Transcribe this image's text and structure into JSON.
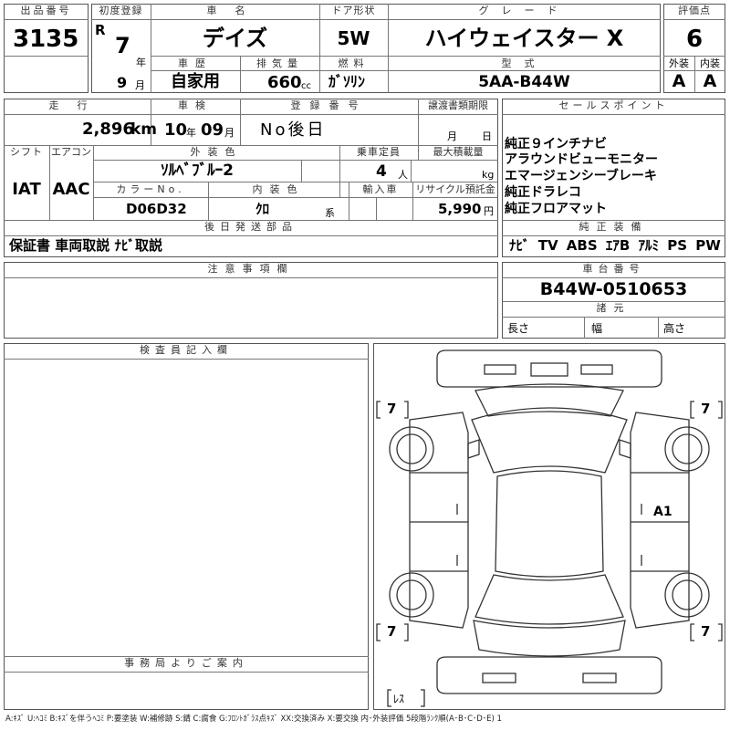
{
  "header": {
    "lot_no_label": "出品番号",
    "lot_no": "3135",
    "first_reg_label": "初度登録",
    "era": "R",
    "year": "7",
    "year_unit": "年",
    "month": "9",
    "month_unit": "月",
    "car_name_label": "車名",
    "car_name": "デイズ",
    "door_label": "ドア形状",
    "door": "5W",
    "grade_label": "グレード",
    "grade": "ハイウェイスター X",
    "score_label": "評価点",
    "score": "6",
    "history_label": "車歴",
    "history": "自家用",
    "displacement_label": "排気量",
    "displacement": "660",
    "displacement_unit": "cc",
    "fuel_label": "燃料",
    "fuel": "ｶﾞｿﾘﾝ",
    "model_label": "型式",
    "model": "5AA-B44W",
    "exterior_label": "外装",
    "exterior": "A",
    "interior_label": "内装",
    "interior": "A"
  },
  "row2": {
    "mileage_label": "走行",
    "mileage": "2,896",
    "mileage_unit": "km",
    "inspection_label": "車検",
    "insp_year": "10",
    "insp_year_unit": "年",
    "insp_month": "09",
    "insp_month_unit": "月",
    "reg_no_label": "登録番号",
    "reg_no": "No後日",
    "transfer_label": "譲渡書類期限",
    "transfer_month_unit": "月",
    "transfer_day_unit": "日",
    "shift_label": "シフト",
    "shift": "IAT",
    "ac_label": "エアコン",
    "ac": "AAC",
    "color_label": "外装色",
    "color": "ｿﾙﾍﾞﾌﾞﾙｰ2",
    "capacity_label": "乗車定員",
    "capacity": "4",
    "capacity_unit": "人",
    "load_label": "最大積載量",
    "load_unit": "kg",
    "color_no_label": "カラーNo.",
    "color_no": "D06D32",
    "int_color_label": "内装色",
    "int_color": "ｸﾛ",
    "int_color_unit": "系",
    "import_label": "輸入車",
    "recycle_label": "リサイクル預託金",
    "recycle": "5,990",
    "recycle_unit": "円",
    "later_label": "後日発送部品",
    "later": "保証書 車両取説 ﾅﾋﾞ取説"
  },
  "sales": {
    "label": "セールスポイント",
    "points": [
      "純正９インチナビ",
      "アラウンドビューモニター",
      "エマージェンシーブレーキ",
      "純正ドラレコ",
      "純正フロアマット"
    ],
    "equip_label": "純正装備",
    "equip": "ﾅﾋﾞ TV ABS ｴｱB ｱﾙﾐ PS PW"
  },
  "notes": {
    "label": "注意事項欄"
  },
  "chassis": {
    "label": "車台番号",
    "number": "B44W-0510653",
    "spec_label": "諸元",
    "length_label": "長さ",
    "width_label": "幅",
    "height_label": "高さ"
  },
  "inspector": {
    "label": "検査員記入欄"
  },
  "office": {
    "label": "事務局よりご案内"
  },
  "diagram": {
    "tire_fl": "7",
    "tire_fr": "7",
    "tire_rl": "7",
    "tire_rr": "7",
    "right_side_note": "A1",
    "spare": "ﾚｽ"
  },
  "legend": "A:ｷｽﾞ U:ﾍｺﾐ B:ｷｽﾞを伴うﾍｺﾐ P:要塗装 W:補修跡 S:錆 C:腐食 G:ﾌﾛﾝﾄｶﾞﾗｽ点ｷｽﾞ XX:交換済み X:要交換 内･外装評価 5段階ﾗﾝｸ順(A･B･C･D･E) 1"
}
